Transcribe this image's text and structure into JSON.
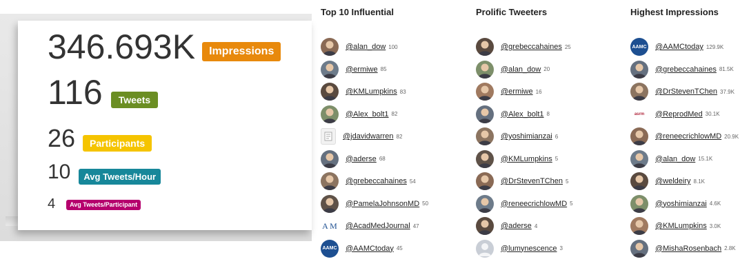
{
  "stats": {
    "impressions_value": "346.693K",
    "impressions_label": "Impressions",
    "tweets_value": "116",
    "tweets_label": "Tweets",
    "participants_value": "26",
    "participants_label": "Participants",
    "avg_hour_value": "10",
    "avg_hour_label": "Avg Tweets/Hour",
    "avg_participant_value": "4",
    "avg_participant_label": "Avg Tweets/Participant"
  },
  "colors": {
    "impressions": "#e8890c",
    "tweets": "#6b8e23",
    "participants": "#f5c400",
    "avg_hour": "#17879a",
    "avg_participant": "#b5006d"
  },
  "influential": {
    "title": "Top 10 Influential",
    "items": [
      {
        "handle": "@alan_dow",
        "count": "100",
        "avatar": "person-avatar"
      },
      {
        "handle": "@ermiwe",
        "count": "85",
        "avatar": "person-avatar"
      },
      {
        "handle": "@KMLumpkins",
        "count": "83",
        "avatar": "person-avatar"
      },
      {
        "handle": "@Alex_bolt1",
        "count": "82",
        "avatar": "person-avatar"
      },
      {
        "handle": "@jdavidwarren",
        "count": "82",
        "avatar": "document-avatar"
      },
      {
        "handle": "@aderse",
        "count": "68",
        "avatar": "person-avatar"
      },
      {
        "handle": "@grebeccahaines",
        "count": "54",
        "avatar": "person-avatar"
      },
      {
        "handle": "@PamelaJohnsonMD",
        "count": "50",
        "avatar": "person-avatar"
      },
      {
        "handle": "@AcadMedJournal",
        "count": "47",
        "avatar": "am-logo-avatar"
      },
      {
        "handle": "@AAMCtoday",
        "count": "45",
        "avatar": "aamc-logo-avatar"
      }
    ]
  },
  "prolific": {
    "title": "Prolific Tweeters",
    "items": [
      {
        "handle": "@grebeccahaines",
        "count": "25",
        "avatar": "person-avatar"
      },
      {
        "handle": "@alan_dow",
        "count": "20",
        "avatar": "person-avatar"
      },
      {
        "handle": "@ermiwe",
        "count": "16",
        "avatar": "person-avatar"
      },
      {
        "handle": "@Alex_bolt1",
        "count": "8",
        "avatar": "person-avatar"
      },
      {
        "handle": "@yoshimianzai",
        "count": "6",
        "avatar": "person-avatar"
      },
      {
        "handle": "@KMLumpkins",
        "count": "5",
        "avatar": "person-avatar"
      },
      {
        "handle": "@DrStevenTChen",
        "count": "5",
        "avatar": "person-avatar"
      },
      {
        "handle": "@reneecrichlowMD",
        "count": "5",
        "avatar": "person-avatar"
      },
      {
        "handle": "@aderse",
        "count": "4",
        "avatar": "person-avatar"
      },
      {
        "handle": "@lumynescence",
        "count": "3",
        "avatar": "default-user-avatar"
      }
    ]
  },
  "impressions_list": {
    "title": "Highest Impressions",
    "items": [
      {
        "handle": "@AAMCtoday",
        "count": "129.9K",
        "avatar": "aamc-logo-avatar"
      },
      {
        "handle": "@grebeccahaines",
        "count": "81.5K",
        "avatar": "person-avatar"
      },
      {
        "handle": "@DrStevenTChen",
        "count": "37.9K",
        "avatar": "person-avatar"
      },
      {
        "handle": "@ReprodMed",
        "count": "30.1K",
        "avatar": "asrm-logo-avatar"
      },
      {
        "handle": "@reneecrichlowMD",
        "count": "20.9K",
        "avatar": "person-avatar"
      },
      {
        "handle": "@alan_dow",
        "count": "15.1K",
        "avatar": "person-avatar"
      },
      {
        "handle": "@weldeiry",
        "count": "8.1K",
        "avatar": "person-avatar"
      },
      {
        "handle": "@yoshimianzai",
        "count": "4.6K",
        "avatar": "person-avatar"
      },
      {
        "handle": "@KMLumpkins",
        "count": "3.0K",
        "avatar": "person-avatar"
      },
      {
        "handle": "@MishaRosenbach",
        "count": "2.8K",
        "avatar": "person-avatar"
      }
    ]
  },
  "logo_text": {
    "am": "A M",
    "aamc": "AAMC",
    "asrm": "asrm"
  }
}
